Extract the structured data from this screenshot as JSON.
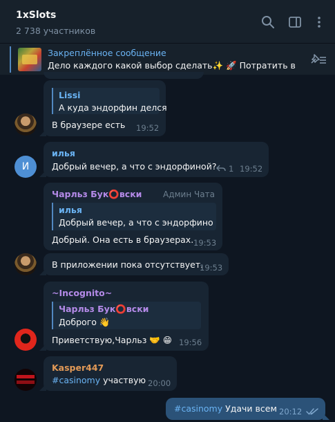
{
  "header": {
    "title": "1xSlots",
    "subtitle": "2 738 участников"
  },
  "pinned": {
    "title": "Закреплённое сообщение",
    "text": "Дело каждого какой выбор сделать✨  🚀 Потратить в..."
  },
  "messages": [
    {
      "reply_name": "Lissi",
      "reply_text": "А куда эндорфин делся",
      "text": "В браузере есть",
      "time": "19:52"
    },
    {
      "sender": "илья",
      "avatar_letter": "И",
      "text": "Добрый вечер, а что с эндорфиной?",
      "replies": "1",
      "time": "19:52"
    },
    {
      "sender": "Чарльз Бук⭕вски",
      "badge": "Админ Чата",
      "reply_name": "илья",
      "reply_text": "Добрый вечер, а что с эндорфино...",
      "text": "Добрый. Она есть в браузерах.",
      "time": "19:53"
    },
    {
      "text": "В приложении пока отсутствует.",
      "time": "19:53"
    },
    {
      "sender": "~Incognito~",
      "reply_name": "Чарльз Бук⭕вски",
      "reply_text": "Доброго 👋",
      "text": "Приветствую,Чарльз 🤝 😁",
      "time": "19:56"
    },
    {
      "sender": "Kasper447",
      "hashtag": "#casinomy",
      "text": " участвую",
      "time": "20:00"
    },
    {
      "hashtag": "#casinomy",
      "text": " Удачи всем",
      "time": "20:12"
    }
  ],
  "colors": {
    "background": "#0e1621",
    "header": "#17212b",
    "bubble_in": "#182533",
    "bubble_out": "#2b5278",
    "accent": "#6ab3f3",
    "sender_purple": "#b48ae8",
    "sender_orange": "#e39a57"
  },
  "icons": [
    "search-icon",
    "sidebar-toggle-icon",
    "more-vertical-icon",
    "pinned-list-icon",
    "reply-arrow-icon",
    "double-check-icon"
  ]
}
